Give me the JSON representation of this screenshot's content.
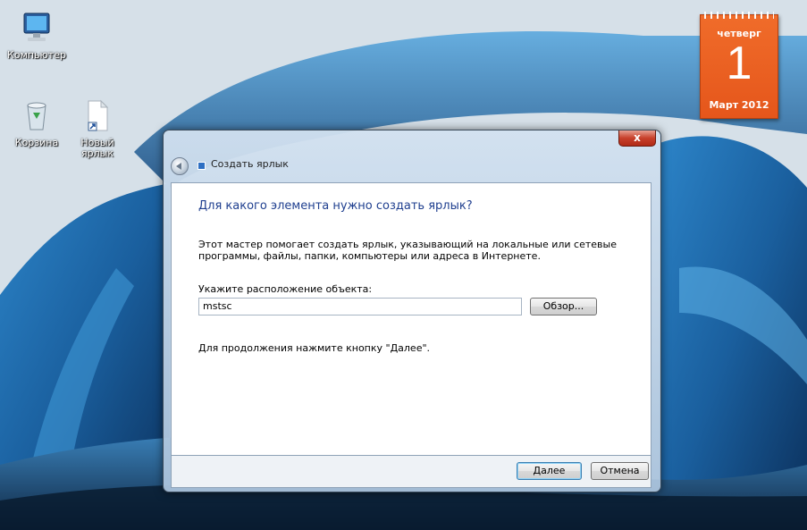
{
  "desktop": {
    "icons": [
      {
        "label": "Компьютер",
        "icon": "computer-icon"
      },
      {
        "label": "Корзина",
        "icon": "recycle-bin-icon"
      },
      {
        "label": "Новый ярлык",
        "icon": "shortcut-file-icon"
      }
    ]
  },
  "calendar": {
    "day_name": "четверг",
    "day_number": "1",
    "month_year": "Март 2012",
    "accent": "#e95d20"
  },
  "dialog": {
    "title": "Создать ярлык",
    "close_label": "x",
    "heading": "Для какого элемента нужно создать ярлык?",
    "description": "Этот мастер помогает создать ярлык, указывающий на локальные или сетевые программы, файлы, папки, компьютеры или адреса в Интернете.",
    "location_label": "Укажите расположение объекта:",
    "location_value": "mstsc",
    "browse_label": "Обзор...",
    "continue_hint": "Для продолжения нажмите кнопку \"Далее\".",
    "next_label": "Далее",
    "cancel_label": "Отмена",
    "heading_color": "#1f3f8f"
  }
}
